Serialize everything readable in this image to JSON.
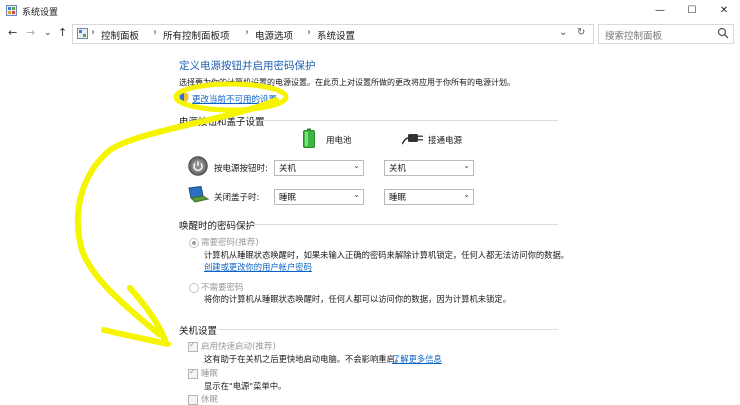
{
  "window": {
    "title": "系统设置",
    "minimize": "—",
    "maximize": "☐",
    "close": "✕"
  },
  "nav": {
    "back": "←",
    "forward": "→",
    "recent": "⌄",
    "up": "↑",
    "refresh": "↻"
  },
  "breadcrumb": [
    "控制面板",
    "所有控制面板项",
    "电源选项",
    "系统设置"
  ],
  "search": {
    "placeholder": "搜索控制面板"
  },
  "page": {
    "title": "定义电源按钮并启用密码保护",
    "desc": "选择要为你的计算机设置的电源设置。在此页上对设置所做的更改将应用于你所有的电源计划。",
    "change_link": "更改当前不可用的设置"
  },
  "power_buttons": {
    "section": "电源按钮和盖子设置",
    "col_battery": "用电池",
    "col_plugged": "接通电源",
    "rows": [
      {
        "label": "按电源按钮时:",
        "battery": "关机",
        "plugged": "关机"
      },
      {
        "label": "关闭盖子时:",
        "battery": "睡眠",
        "plugged": "睡眠"
      }
    ]
  },
  "password": {
    "section": "唤醒时的密码保护",
    "opt1_label": "需要密码(推荐)",
    "opt1_desc": "计算机从睡眠状态唤醒时，如果未输入正确的密码来解除计算机锁定，任何人都无法访问你的数据。",
    "opt1_link": "创建或更改你的用户帐户密码",
    "opt2_label": "不需要密码",
    "opt2_desc": "将你的计算机从睡眠状态唤醒时，任何人都可以访问你的数据，因为计算机未锁定。"
  },
  "shutdown": {
    "section": "关机设置",
    "fast_label": "启用快速启动(推荐)",
    "fast_desc": "这有助于在关机之后更快地启动电脑。不会影响重启。",
    "fast_link": "了解更多信息",
    "sleep_label": "睡眠",
    "sleep_desc": "显示在\"电源\"菜单中。",
    "hib_label": "休眠"
  },
  "colors": {
    "annotation": "#f5f500",
    "link": "#0a63c9",
    "title": "#1f5fb0"
  }
}
